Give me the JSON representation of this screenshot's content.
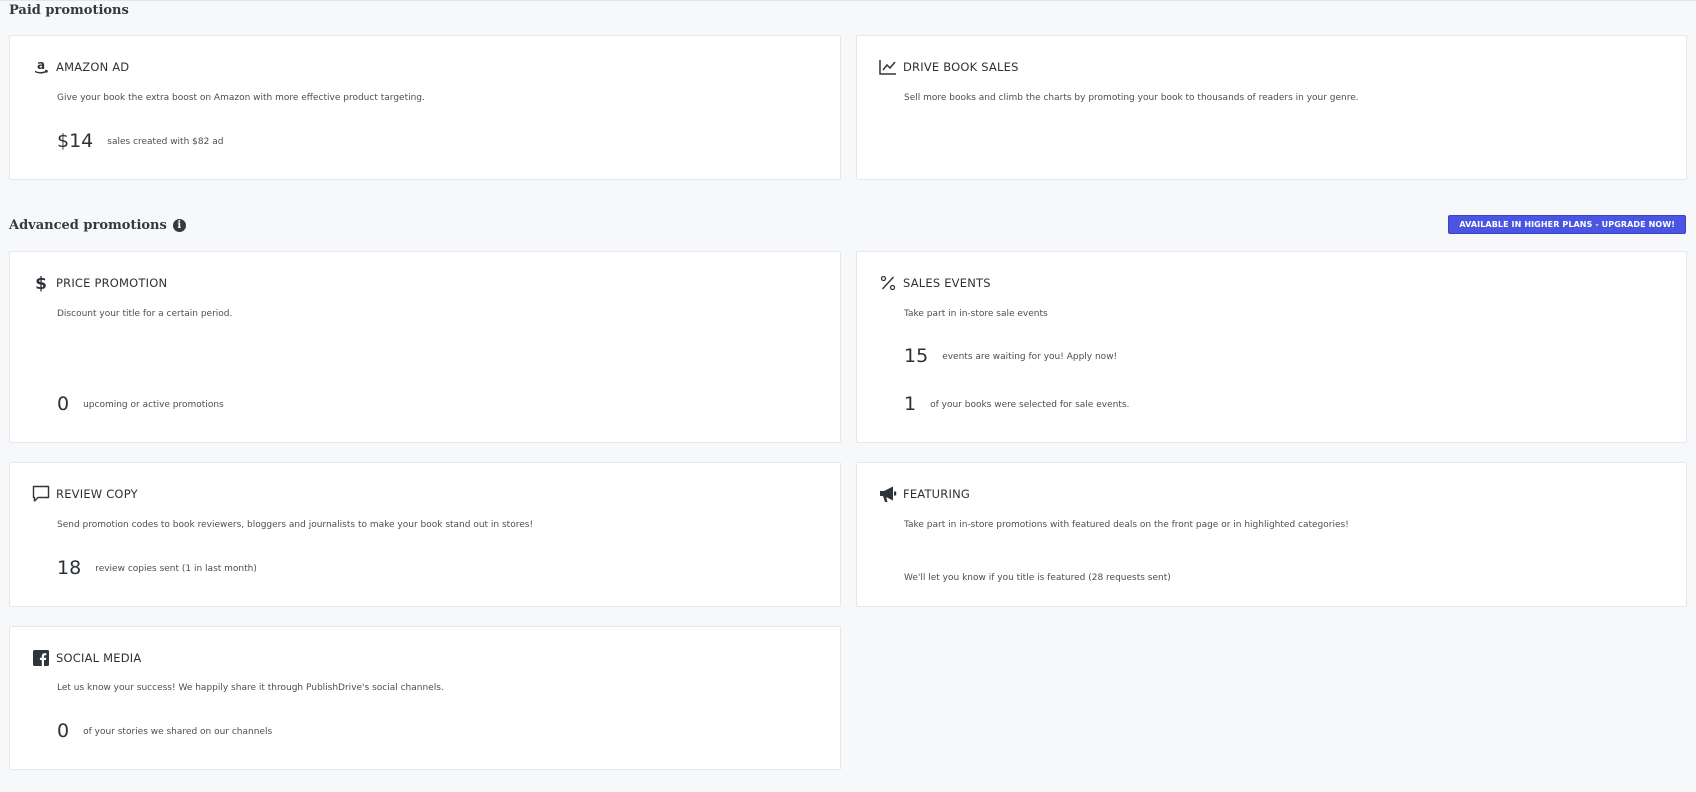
{
  "sections": {
    "paid_title": "Paid promotions",
    "advanced_title": "Advanced promotions",
    "info_glyph": "i",
    "upgrade_label": "AVAILABLE IN HIGHER PLANS - UPGRADE NOW!"
  },
  "colors": {
    "accent": "#4a56e2",
    "background": "#f7f8fa",
    "card": "#ffffff",
    "text": "#2c3137"
  },
  "cards": {
    "amazon": {
      "icon": "amazon-icon",
      "title": "AMAZON AD",
      "desc": "Give your book the extra boost on Amazon with more effective product targeting.",
      "stat_value": "$14",
      "stat_label": "sales created with $82 ad"
    },
    "drive": {
      "icon": "line-chart-icon",
      "title": "DRIVE BOOK SALES",
      "desc": "Sell more books and climb the charts by promoting your book to thousands of readers in your genre."
    },
    "price": {
      "icon": "dollar-icon",
      "title": "PRICE PROMOTION",
      "desc": "Discount your title for a certain period.",
      "stat_value": "0",
      "stat_label": "upcoming or active promotions"
    },
    "sales_events": {
      "icon": "percent-icon",
      "title": "SALES EVENTS",
      "desc": "Take part in in-store sale events",
      "stat1_value": "15",
      "stat1_label": "events are waiting for you! Apply now!",
      "stat2_value": "1",
      "stat2_label": "of your books were selected for sale events."
    },
    "review": {
      "icon": "comment-icon",
      "title": "REVIEW COPY",
      "desc": "Send promotion codes to book reviewers, bloggers and journalists to make your book stand out in stores!",
      "stat_value": "18",
      "stat_label": "review copies sent (1 in last month)"
    },
    "featuring": {
      "icon": "megaphone-icon",
      "title": "FEATURING",
      "desc": "Take part in in-store promotions with featured deals on the front page or in highlighted categories!",
      "note": "We'll let you know if you title is featured (28 requests sent)"
    },
    "social": {
      "icon": "facebook-icon",
      "title": "SOCIAL MEDIA",
      "desc": "Let us know your success! We happily share it through PublishDrive's social channels.",
      "stat_value": "0",
      "stat_label": "of your stories we shared on our channels"
    }
  }
}
